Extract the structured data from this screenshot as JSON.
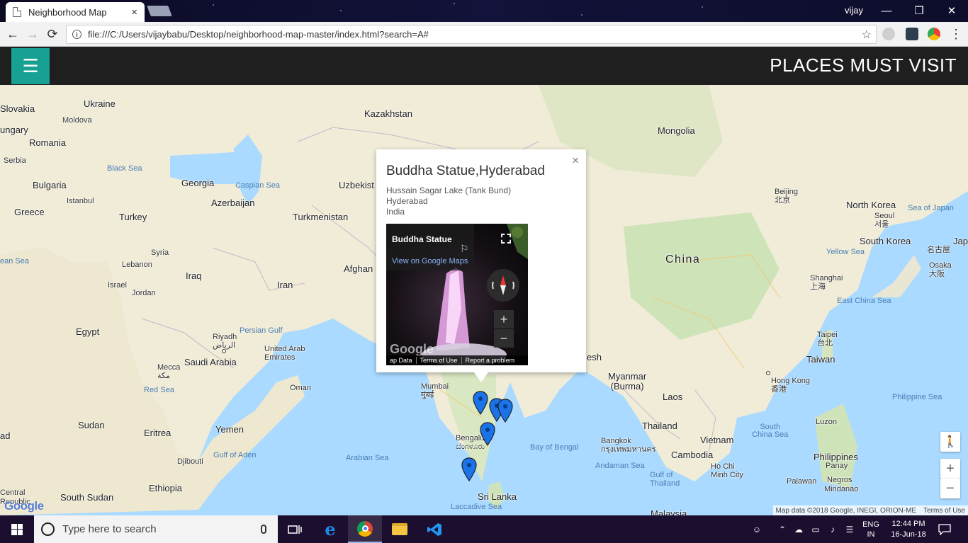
{
  "browser": {
    "tab_title": "Neighborhood Map",
    "tab_close": "×",
    "user_name": "vijay",
    "minimize": "—",
    "restore": "❐",
    "close": "✕",
    "back": "←",
    "forward": "→",
    "reload": "⟳",
    "info": "i",
    "url": "file:///C:/Users/vijaybabu/Desktop/neighborhood-map-master/index.html?search=A#",
    "bookmark": "☆",
    "menu": "⋮"
  },
  "app": {
    "menu_icon": "☰",
    "title": "PLACES MUST VISIT"
  },
  "map": {
    "labels": {
      "slovakia": "Slovakia",
      "ukraine": "Ukraine",
      "moldova": "Moldova",
      "hungary": "ungary",
      "romania": "Romania",
      "serbia": "Serbia",
      "bulgaria": "Bulgaria",
      "greece": "Greece",
      "turkey": "Turkey",
      "istanbul": "Istanbul",
      "black_sea": "Black Sea",
      "georgia": "Georgia",
      "azerbaijan": "Azerbaijan",
      "caspian_sea": "Caspian Sea",
      "kazakhstan": "Kazakhstan",
      "uzbekistan": "Uzbekist",
      "turkmenistan": "Turkmenistan",
      "mongolia": "Mongolia",
      "syria": "Syria",
      "lebanon": "Lebanon",
      "israel": "Israel",
      "jordan": "Jordan",
      "iraq": "Iraq",
      "iran": "Iran",
      "afghanistan": "Afghan",
      "egypt": "Egypt",
      "riyadh": "Riyadh\nالرياض",
      "persian_gulf": "Persian Gulf",
      "saudi_arabia": "Saudi Arabia",
      "uae": "United Arab\nEmirates",
      "mecca": "Mecca\nمكة",
      "red_sea": "Red Sea",
      "oman": "Oman",
      "sudan": "Sudan",
      "eritrea": "Eritrea",
      "yemen": "Yemen",
      "djibouti": "Djibouti",
      "gulf_of_aden": "Gulf of Aden",
      "ethiopia": "Ethiopia",
      "south_sudan": "South Sudan",
      "central": "Central\nRepublic",
      "chad": "ad",
      "arabian_sea": "Arabian Sea",
      "mumbai": "Mumbai\nमुंबई",
      "bengaluru": "Bengaluru\nಬೆಂಗಳೂರು",
      "sri_lanka": "Sri Lanka",
      "laccadive_sea": "Laccadive Sea",
      "bay_of_bengal": "Bay of Bengal",
      "bangladesh": "esh",
      "myanmar": "Myanmar\n(Burma)",
      "laos": "Laos",
      "thailand": "Thailand",
      "bangkok": "Bangkok\nกรุงเทพมหานคร",
      "andaman_sea": "Andaman Sea",
      "gulf_of_thailand": "Gulf of\nThailand",
      "cambodia": "Cambodia",
      "vietnam": "Vietnam",
      "ho_chi_minh": "Ho Chi\nMinh City",
      "malaysia": "Malaysia",
      "china": "China",
      "beijing": "Beijing\n北京",
      "north_korea": "North Korea",
      "seoul": "Seoul\n서울",
      "south_korea": "South Korea",
      "sea_of_japan": "Sea of Japan",
      "japan": "Jap",
      "nagoya": "名古屋",
      "osaka": "Osaka\n大阪",
      "yellow_sea": "Yellow Sea",
      "shanghai": "Shanghai\n上海",
      "east_china_sea": "East China Sea",
      "taipei": "Taipei\n台北",
      "taiwan": "Taiwan",
      "hong_kong": "Hong Kong\n香港",
      "south_china_sea": "South\nChina Sea",
      "philippine_sea": "Philippine Sea",
      "luzon": "Luzon",
      "philippines": "Philippines",
      "panay": "Panay",
      "negros": "Negros",
      "mindanao": "Mindanao",
      "palawan": "Palawan",
      "mediterranean": "ean Sea"
    },
    "attribution": "Map data ©2018 Google, INEGI, ORION-ME",
    "terms": "Terms of Use",
    "google": "Google",
    "zoom_in": "+",
    "zoom_out": "−",
    "pegman": "🚶"
  },
  "info_window": {
    "close": "×",
    "title": "Buddha Statue,Hyderabad",
    "address_line1": "Hussain Sagar Lake (Tank Bund)",
    "address_line2": "Hyderabad",
    "address_line3": "India",
    "streetview": {
      "name": "Buddha Statue",
      "link": "View on Google Maps",
      "zoom_in": "+",
      "zoom_out": "−",
      "google": "Google",
      "footer": [
        "ap Data",
        "Terms of Use",
        "Report a problem"
      ]
    }
  },
  "taskbar": {
    "search_placeholder": "Type here to search",
    "lang_top": "ENG",
    "lang_bottom": "IN",
    "time": "12:44 PM",
    "date": "16-Jun-18"
  }
}
